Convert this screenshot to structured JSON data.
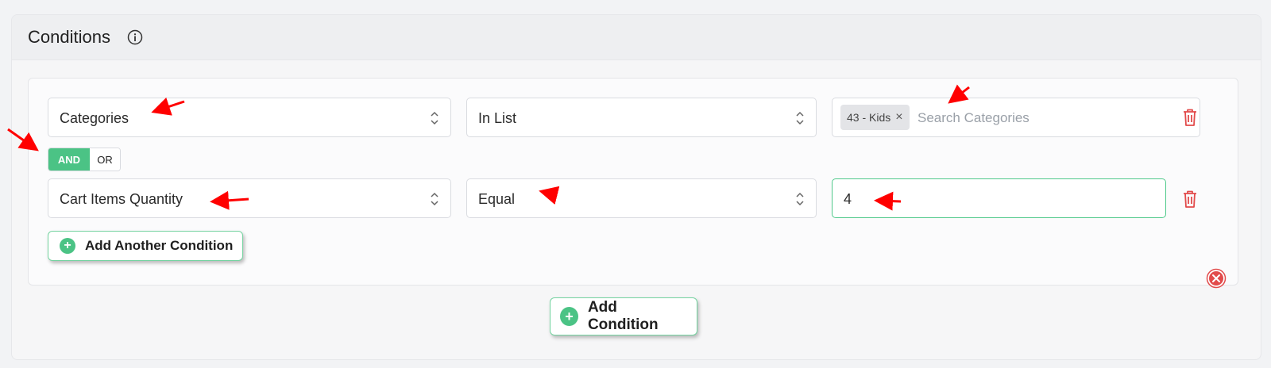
{
  "panel": {
    "title": "Conditions"
  },
  "conditions": [
    {
      "field": "Categories",
      "operator": "In List",
      "tags": [
        "43 - Kids"
      ],
      "search_placeholder": "Search Categories"
    },
    {
      "field": "Cart Items Quantity",
      "operator": "Equal",
      "value": "4"
    }
  ],
  "logic_toggle": {
    "active": "AND",
    "inactive": "OR"
  },
  "buttons": {
    "add_another_condition": "Add Another Condition",
    "add_condition": "Add Condition"
  },
  "colors": {
    "accent_green": "#4bc385",
    "delete_red": "#e24b4b",
    "annotation_arrow": "#ff0000"
  },
  "icons": [
    "info-icon",
    "chevron-updown-icon",
    "tag-remove-icon",
    "trash-icon",
    "plus-circle-icon",
    "close-circle-icon"
  ]
}
